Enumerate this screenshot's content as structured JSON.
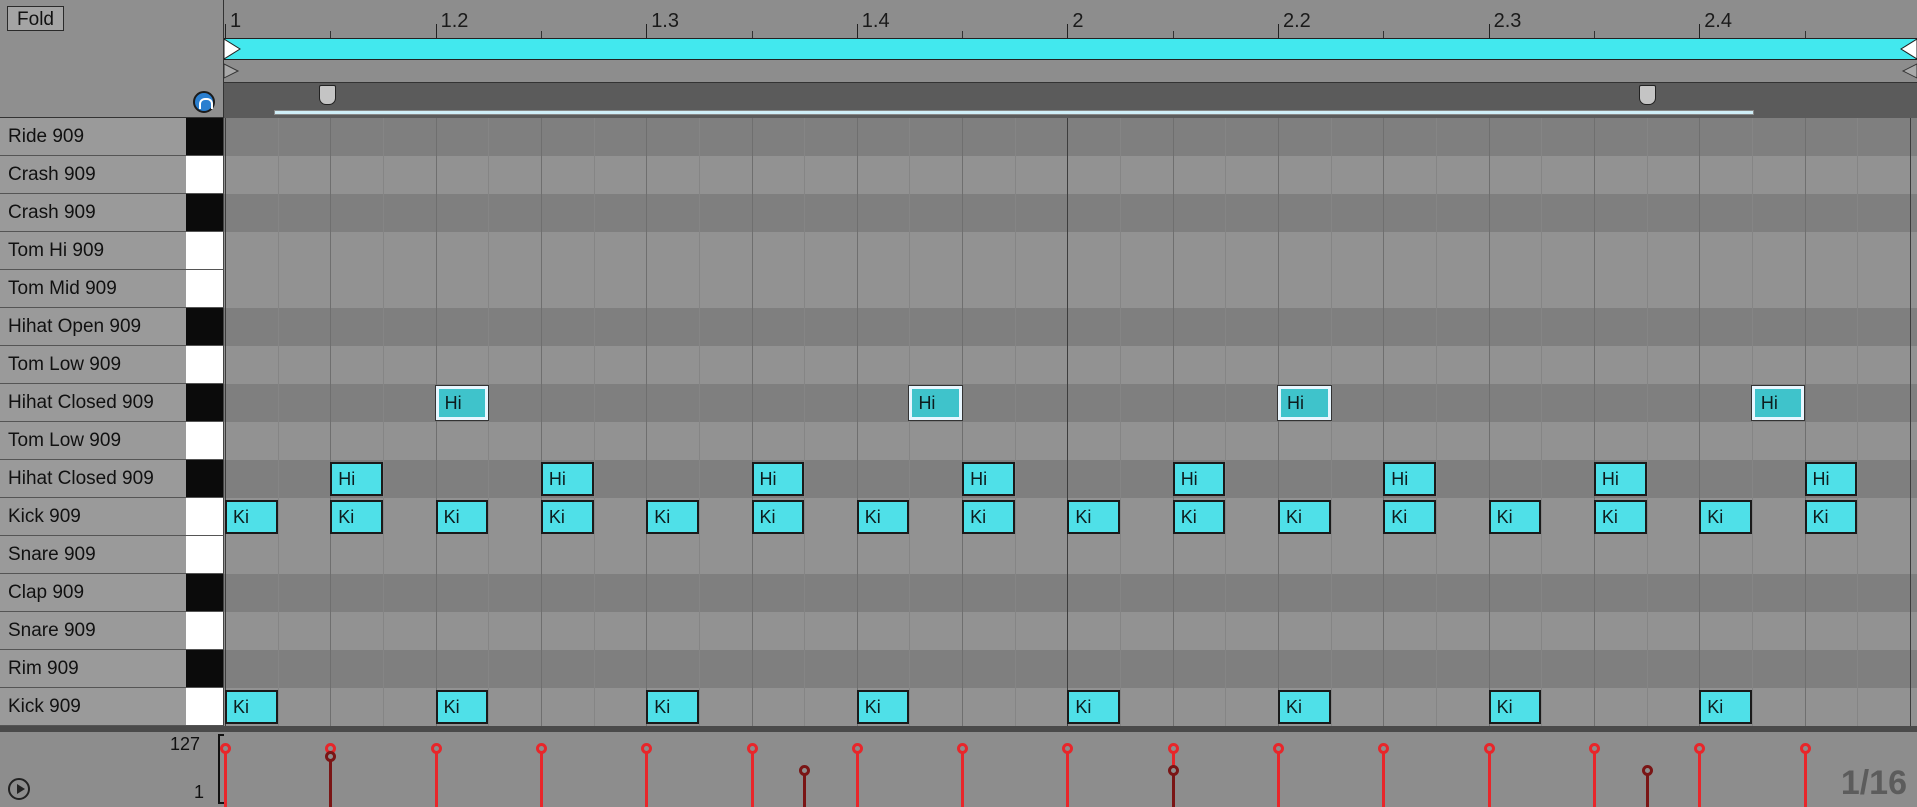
{
  "header": {
    "fold_label": "Fold"
  },
  "ruler": {
    "labels": [
      "1",
      "1.2",
      "1.3",
      "1.4",
      "2",
      "2.2",
      "2.3",
      "2.4"
    ]
  },
  "lanes": [
    {
      "name": "Ride 909",
      "key": "black"
    },
    {
      "name": "Crash 909",
      "key": "white"
    },
    {
      "name": "Crash 909",
      "key": "black"
    },
    {
      "name": "Tom Hi 909",
      "key": "white"
    },
    {
      "name": "Tom Mid 909",
      "key": "white"
    },
    {
      "name": "Hihat Open 909",
      "key": "black"
    },
    {
      "name": "Tom Low 909",
      "key": "white"
    },
    {
      "name": "Hihat Closed 909",
      "key": "black"
    },
    {
      "name": "Tom Low 909",
      "key": "white"
    },
    {
      "name": "Hihat Closed 909",
      "key": "black"
    },
    {
      "name": "Kick 909",
      "key": "white"
    },
    {
      "name": "Snare 909",
      "key": "white"
    },
    {
      "name": "Clap 909",
      "key": "black"
    },
    {
      "name": "Snare 909",
      "key": "white"
    },
    {
      "name": "Rim 909",
      "key": "black"
    },
    {
      "name": "Kick 909",
      "key": "white"
    }
  ],
  "notes": [
    {
      "lane": 7,
      "step": 2,
      "label": "Hi",
      "selected": true
    },
    {
      "lane": 7,
      "step": 6.5,
      "label": "Hi",
      "selected": true
    },
    {
      "lane": 7,
      "step": 10,
      "label": "Hi",
      "selected": true
    },
    {
      "lane": 7,
      "step": 14.5,
      "label": "Hi",
      "selected": true
    },
    {
      "lane": 9,
      "step": 1,
      "label": "Hi"
    },
    {
      "lane": 9,
      "step": 3,
      "label": "Hi"
    },
    {
      "lane": 9,
      "step": 5,
      "label": "Hi"
    },
    {
      "lane": 9,
      "step": 7,
      "label": "Hi"
    },
    {
      "lane": 9,
      "step": 9,
      "label": "Hi"
    },
    {
      "lane": 9,
      "step": 11,
      "label": "Hi"
    },
    {
      "lane": 9,
      "step": 13,
      "label": "Hi"
    },
    {
      "lane": 9,
      "step": 15,
      "label": "Hi"
    },
    {
      "lane": 10,
      "step": 0,
      "label": "Ki"
    },
    {
      "lane": 10,
      "step": 1,
      "label": "Ki"
    },
    {
      "lane": 10,
      "step": 2,
      "label": "Ki"
    },
    {
      "lane": 10,
      "step": 3,
      "label": "Ki"
    },
    {
      "lane": 10,
      "step": 4,
      "label": "Ki"
    },
    {
      "lane": 10,
      "step": 5,
      "label": "Ki"
    },
    {
      "lane": 10,
      "step": 6,
      "label": "Ki"
    },
    {
      "lane": 10,
      "step": 7,
      "label": "Ki"
    },
    {
      "lane": 10,
      "step": 8,
      "label": "Ki"
    },
    {
      "lane": 10,
      "step": 9,
      "label": "Ki"
    },
    {
      "lane": 10,
      "step": 10,
      "label": "Ki"
    },
    {
      "lane": 10,
      "step": 11,
      "label": "Ki"
    },
    {
      "lane": 10,
      "step": 12,
      "label": "Ki"
    },
    {
      "lane": 10,
      "step": 13,
      "label": "Ki"
    },
    {
      "lane": 10,
      "step": 14,
      "label": "Ki"
    },
    {
      "lane": 10,
      "step": 15,
      "label": "Ki"
    },
    {
      "lane": 15,
      "step": 0,
      "label": "Ki"
    },
    {
      "lane": 15,
      "step": 2,
      "label": "Ki"
    },
    {
      "lane": 15,
      "step": 4,
      "label": "Ki"
    },
    {
      "lane": 15,
      "step": 6,
      "label": "Ki"
    },
    {
      "lane": 15,
      "step": 8,
      "label": "Ki"
    },
    {
      "lane": 15,
      "step": 10,
      "label": "Ki"
    },
    {
      "lane": 15,
      "step": 12,
      "label": "Ki"
    },
    {
      "lane": 15,
      "step": 14,
      "label": "Ki"
    }
  ],
  "velocity": {
    "max_label": "127",
    "min_label": "1",
    "grid_label": "1/16",
    "bars": [
      {
        "step": 0,
        "value": 127
      },
      {
        "step": 1,
        "value": 127
      },
      {
        "step": 1,
        "value": 110,
        "dim": true
      },
      {
        "step": 2,
        "value": 127
      },
      {
        "step": 3,
        "value": 127
      },
      {
        "step": 4,
        "value": 127
      },
      {
        "step": 5,
        "value": 127
      },
      {
        "step": 5.5,
        "value": 80,
        "dim": true
      },
      {
        "step": 6,
        "value": 127
      },
      {
        "step": 7,
        "value": 127
      },
      {
        "step": 8,
        "value": 127
      },
      {
        "step": 9,
        "value": 127
      },
      {
        "step": 9,
        "value": 80,
        "dim": true
      },
      {
        "step": 10,
        "value": 127
      },
      {
        "step": 11,
        "value": 127
      },
      {
        "step": 12,
        "value": 127
      },
      {
        "step": 13,
        "value": 127
      },
      {
        "step": 13.5,
        "value": 80,
        "dim": true
      },
      {
        "step": 14,
        "value": 127
      },
      {
        "step": 15,
        "value": 127
      }
    ]
  },
  "colors": {
    "note": "#4fe0e8",
    "loop": "#42e8ee",
    "velocity_active": "#e8262a",
    "velocity_dim": "#7a1515"
  }
}
